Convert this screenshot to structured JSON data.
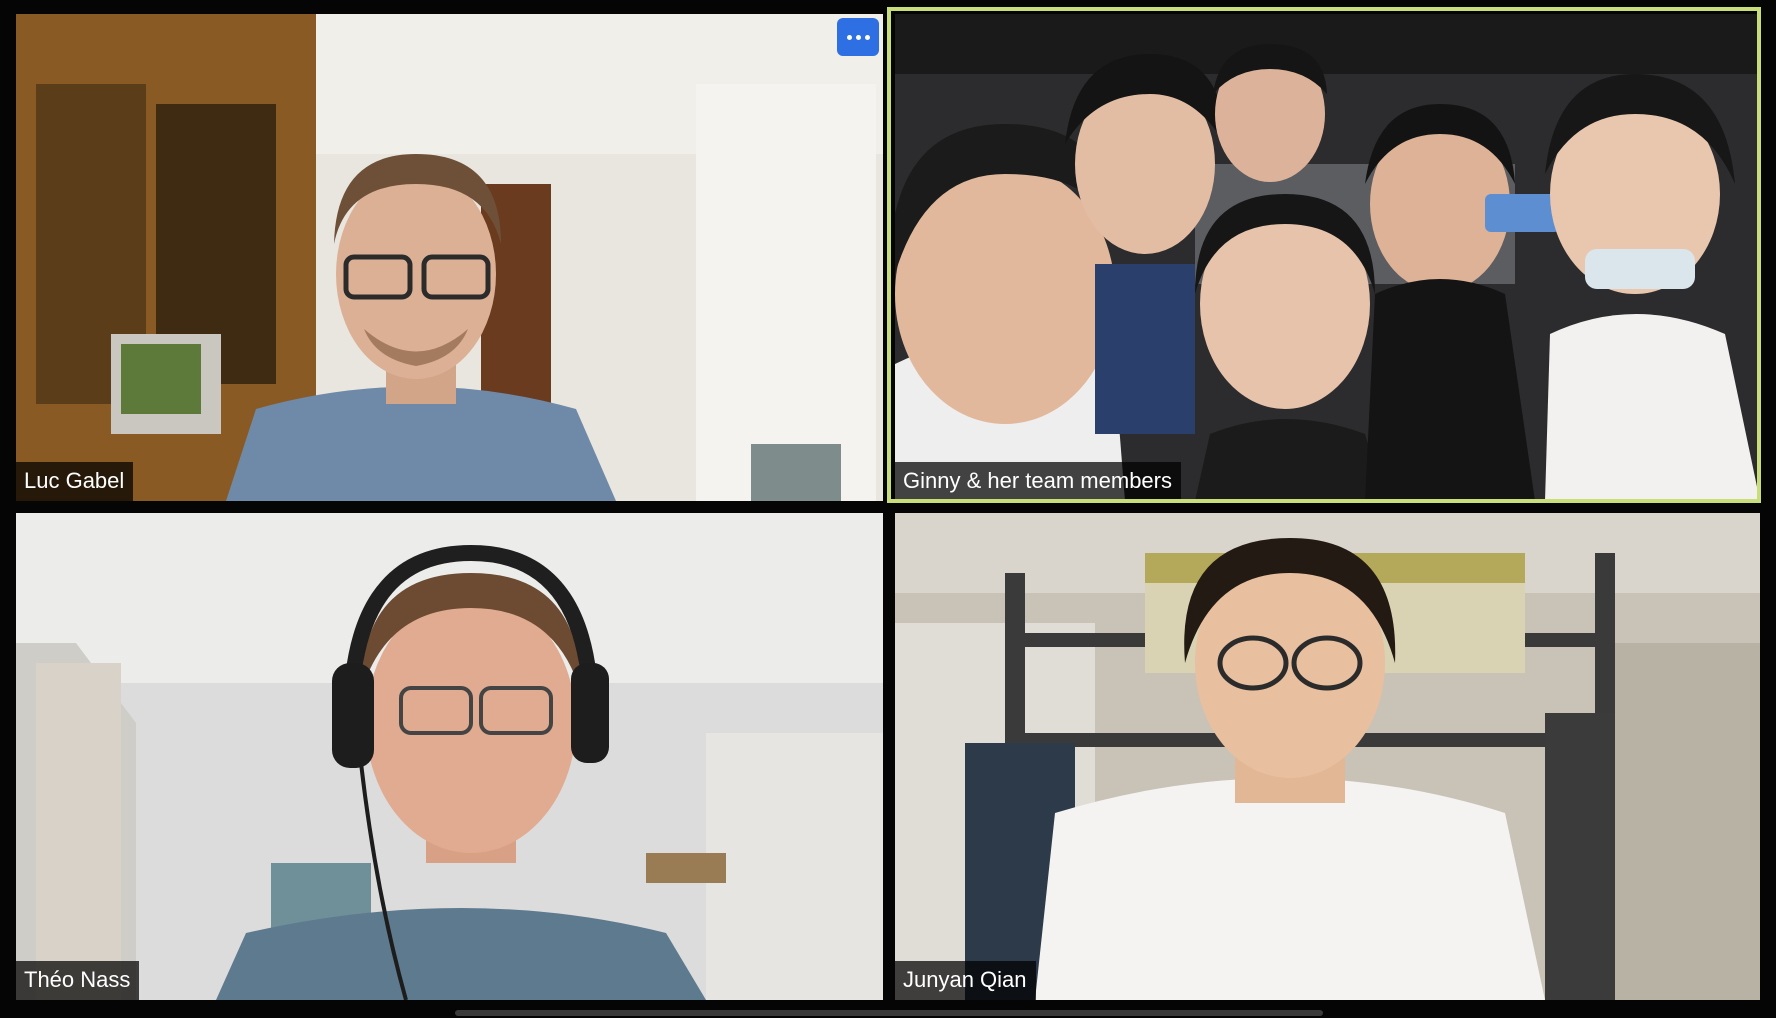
{
  "meeting": {
    "more_options_icon": "ellipsis-icon",
    "active_speaker_color": "#c9dd7a",
    "button_color": "#2f6fe4"
  },
  "participants": [
    {
      "name": "Luc Gabel"
    },
    {
      "name": "Ginny & her team members"
    },
    {
      "name": "Théo Nass"
    },
    {
      "name": "Junyan Qian"
    }
  ]
}
